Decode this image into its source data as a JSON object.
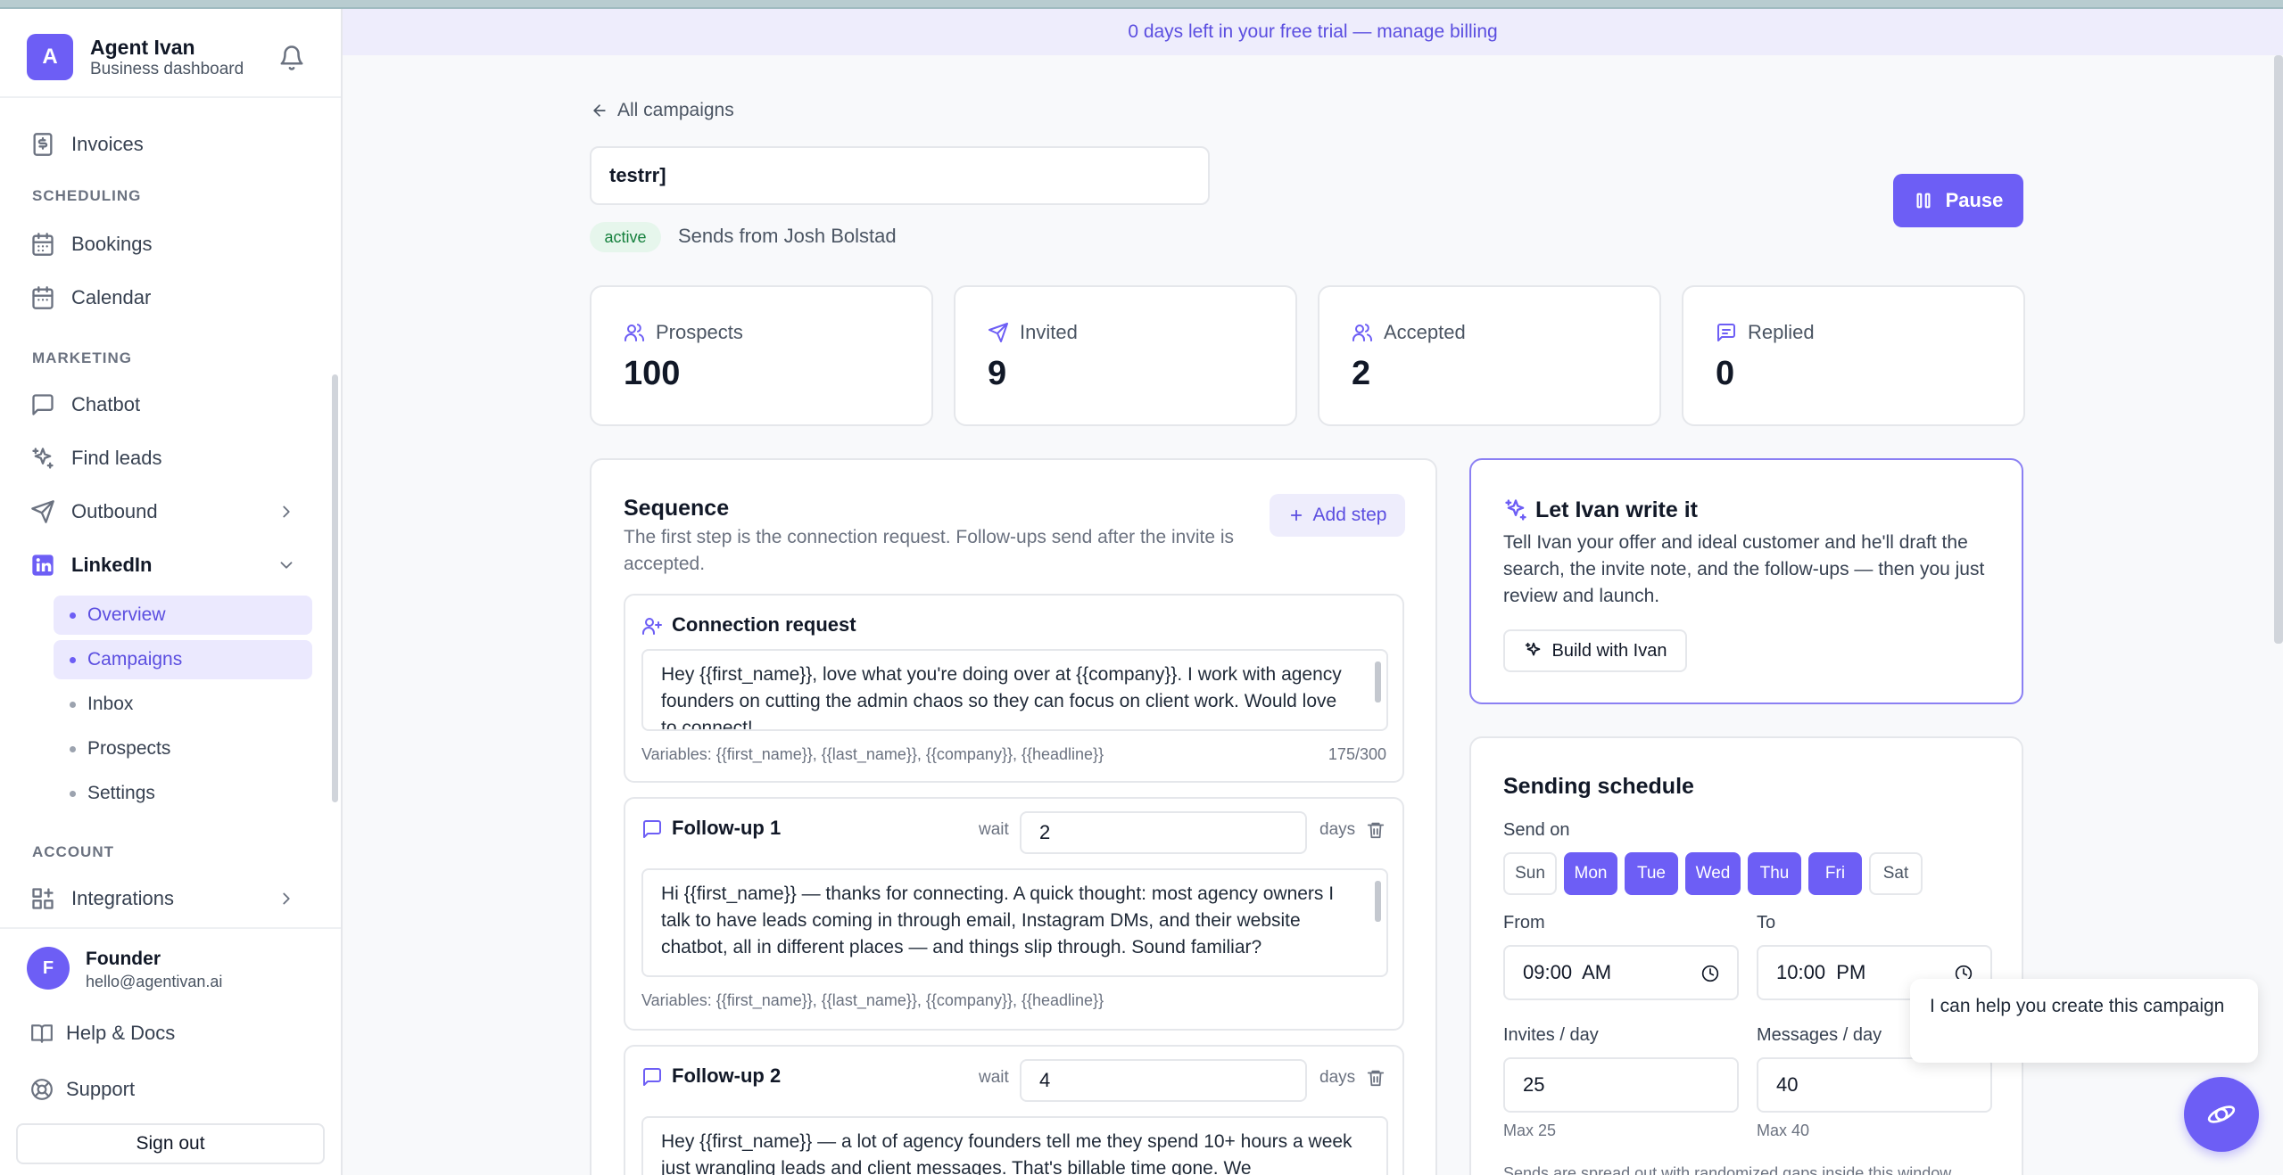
{
  "sidebar": {
    "brand": {
      "initial": "A",
      "title": "Agent Ivan",
      "subtitle": "Business dashboard"
    },
    "nav": {
      "invoices": "Invoices",
      "scheduling_header": "SCHEDULING",
      "bookings": "Bookings",
      "calendar": "Calendar",
      "marketing_header": "MARKETING",
      "chatbot": "Chatbot",
      "find_leads": "Find leads",
      "outbound": "Outbound",
      "linkedin": "LinkedIn",
      "linkedin_sub": [
        "Overview",
        "Campaigns",
        "Inbox",
        "Prospects",
        "Settings"
      ],
      "account_header": "ACCOUNT",
      "integrations": "Integrations"
    },
    "user": {
      "initial": "F",
      "name": "Founder",
      "email": "hello@agentivan.ai"
    },
    "help": "Help & Docs",
    "support": "Support",
    "signout": "Sign out"
  },
  "trial_banner": "0 days left in your free trial — manage billing",
  "campaign": {
    "back_label": "All campaigns",
    "name": "testrr]",
    "status": "active",
    "sends_from": "Sends from Josh Bolstad",
    "pause_label": "Pause"
  },
  "stats": [
    {
      "label": "Prospects",
      "value": "100"
    },
    {
      "label": "Invited",
      "value": "9"
    },
    {
      "label": "Accepted",
      "value": "2"
    },
    {
      "label": "Replied",
      "value": "0"
    }
  ],
  "sequence": {
    "title": "Sequence",
    "description": "The first step is the connection request. Follow-ups send after the invite is accepted.",
    "add_step": "Add step",
    "connection": {
      "title": "Connection request",
      "message": "Hey {{first_name}}, love what you're doing over at {{company}}. I work with agency founders on cutting the admin chaos so they can focus on client work. Would love to connect!",
      "variables": "Variables: {{first_name}}, {{last_name}}, {{company}}, {{headline}}",
      "count": "175/300"
    },
    "followups": [
      {
        "title": "Follow-up 1",
        "wait_label": "wait",
        "wait_value": "2",
        "days_label": "days",
        "message": "Hi {{first_name}} — thanks for connecting. A quick thought: most agency owners I talk to have leads coming in through email, Instagram DMs, and their website chatbot, all in different places — and things slip through. Sound familiar?",
        "variables": "Variables: {{first_name}}, {{last_name}}, {{company}}, {{headline}}"
      },
      {
        "title": "Follow-up 2",
        "wait_label": "wait",
        "wait_value": "4",
        "days_label": "days",
        "message": "Hey {{first_name}} — a lot of agency founders tell me they spend 10+ hours a week just wrangling leads and client messages. That's billable time gone. We"
      }
    ]
  },
  "ivan_card": {
    "title": "Let Ivan write it",
    "description": "Tell Ivan your offer and ideal customer and he'll draft the search, the invite note, and the follow-ups — then you just review and launch.",
    "button": "Build with Ivan"
  },
  "schedule": {
    "title": "Sending schedule",
    "send_on_label": "Send on",
    "days": [
      {
        "label": "Sun",
        "on": false
      },
      {
        "label": "Mon",
        "on": true
      },
      {
        "label": "Tue",
        "on": true
      },
      {
        "label": "Wed",
        "on": true
      },
      {
        "label": "Thu",
        "on": true
      },
      {
        "label": "Fri",
        "on": true
      },
      {
        "label": "Sat",
        "on": false
      }
    ],
    "from_label": "From",
    "from_value": "09:00  AM",
    "to_label": "To",
    "to_value": "10:00  PM",
    "invites_label": "Invites / day",
    "invites_value": "25",
    "invites_max": "Max 25",
    "messages_label": "Messages / day",
    "messages_value": "40",
    "messages_max": "Max 40",
    "footnote": "Sends are spread out with randomized gaps inside this window."
  },
  "assistant": {
    "bubble": "I can help you create this campaign"
  },
  "colors": {
    "accent": "#6d5ef5",
    "accent_soft": "#ebe9fe",
    "success": "#15803d"
  }
}
